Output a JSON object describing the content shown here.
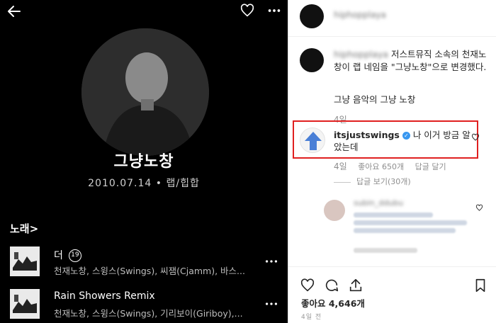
{
  "music": {
    "artist_name": "그냥노창",
    "artist_meta": "2010.07.14 • 랩/힙합",
    "songs_header": "노래>",
    "songs": [
      {
        "title": "더",
        "badge": "19",
        "artists": "천재노창, 스윙스(Swings), 씨잼(Cjamm), 바스..."
      },
      {
        "title": "Rain Showers Remix",
        "badge": "",
        "artists": "천재노창, 스윙스(Swings), 기리보이(Giriboy),..."
      }
    ]
  },
  "instagram": {
    "caption": "저스트뮤직 소속의 천재노창이 랩 네임을 \"그냥노창\"으로 변경했다.",
    "caption_line2": "그냥 음악의 그냥 노창",
    "caption_time": "4일",
    "comment": {
      "username": "itsjustswings",
      "text": "나 이거 방금 알았는데",
      "time": "4일",
      "likes": "좋아요 650개",
      "reply": "답글 달기",
      "view_replies": "답글 보기(30개)"
    },
    "likes_total": "좋아요 4,646개",
    "posted": "4일 전"
  },
  "colors": {
    "highlight": "#e02020",
    "verified": "#3897f0",
    "arrow": "#4a7fd6"
  }
}
